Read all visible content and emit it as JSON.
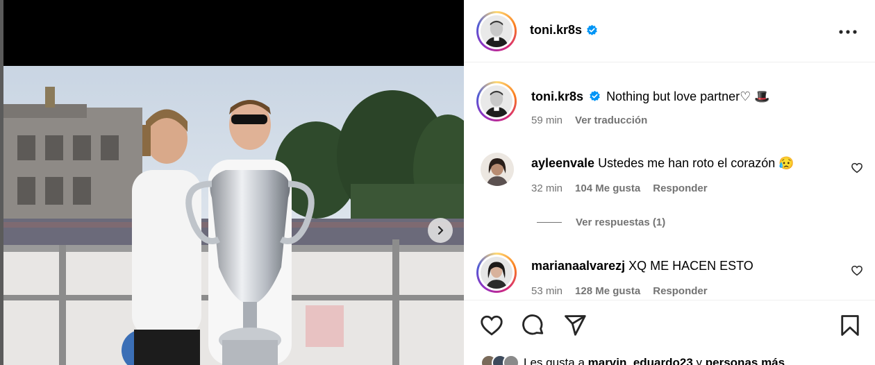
{
  "post": {
    "username": "toni.kr8s",
    "verified": true,
    "more_icon": "more-horizontal-icon"
  },
  "caption": {
    "username": "toni.kr8s",
    "text": "Nothing but love partner♡ 🎩",
    "time": "59 min",
    "translate": "Ver traducción"
  },
  "comments": [
    {
      "username": "ayleenvale",
      "text": "Ustedes me han roto el corazón 😥",
      "time": "32 min",
      "likes": "104 Me gusta",
      "reply": "Responder",
      "view_replies": "Ver respuestas (1)"
    },
    {
      "username": "marianaalvarezj",
      "text": "XQ ME HACEN ESTO",
      "time": "53 min",
      "likes": "128 Me gusta",
      "reply": "Responder"
    }
  ],
  "actions": {
    "like_icon": "heart-icon",
    "comment_icon": "comment-icon",
    "share_icon": "send-icon",
    "save_icon": "bookmark-icon"
  },
  "liked_by": {
    "prefix": "Les gusta a ",
    "user": "marvin_eduardo23",
    "middle": " y ",
    "others": "personas más"
  },
  "media": {
    "next_icon": "chevron-right-icon",
    "description": "",
    "background": "#000000"
  },
  "colors": {
    "verified": "#0095f6",
    "meta_text": "#737373",
    "border": "#efefef"
  }
}
